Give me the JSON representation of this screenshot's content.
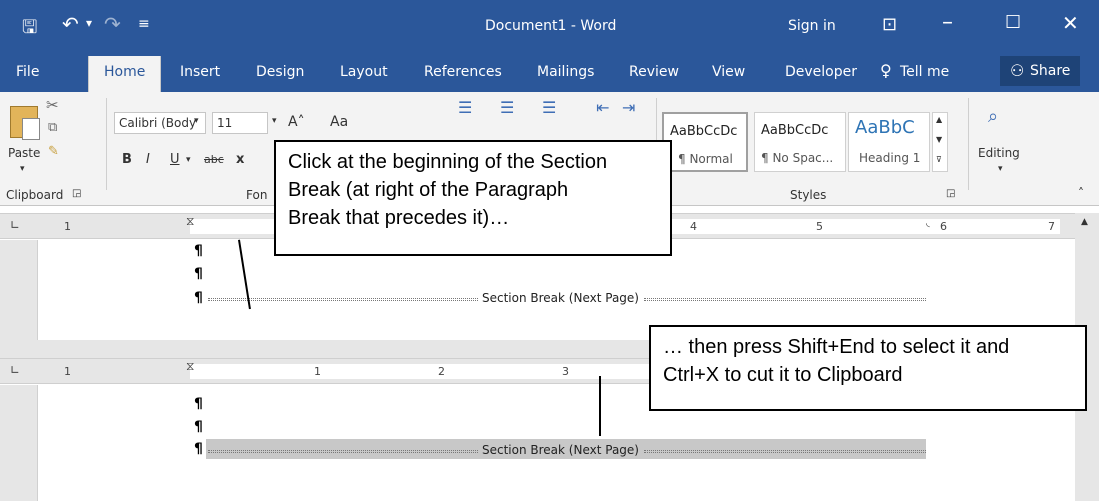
{
  "title_bar": {
    "title": "Document1 - Word",
    "sign_in": "Sign in",
    "undo_icon": "undo-icon",
    "redo_icon": "redo-icon",
    "save_icon": "save-icon"
  },
  "tabs": [
    "File",
    "Home",
    "Insert",
    "Design",
    "Layout",
    "References",
    "Mailings",
    "Review",
    "View",
    "Developer",
    "Tell me",
    "Share"
  ],
  "ribbon": {
    "paste_label": "Paste",
    "clipboard_label": "Clipboard",
    "font_name": "Calibri (Body",
    "font_size": "11",
    "font_label": "Fon",
    "bold": "B",
    "italic": "I",
    "underline": "U",
    "strike": "abc",
    "subscript": "x",
    "aa": "Aa",
    "styles": [
      {
        "sample": "AaBbCcDc",
        "name": "¶ Normal"
      },
      {
        "sample": "AaBbCcDc",
        "name": "¶ No Spac..."
      },
      {
        "sample": "AaBbC",
        "name": "Heading 1"
      }
    ],
    "styles_label": "Styles",
    "editing_label": "Editing"
  },
  "ruler_numbers": [
    "1",
    "1",
    "2",
    "3",
    "4",
    "5",
    "6",
    "7"
  ],
  "page1": {
    "pilcrow": "¶",
    "section_break": "Section Break (Next Page)"
  },
  "page2": {
    "pilcrow": "¶",
    "section_break": "Section Break (Next Page)"
  },
  "callouts": {
    "first": [
      "Click at the beginning of the Section",
      "Break (at right of the Paragraph",
      "Break that precedes it)…"
    ],
    "second": [
      "… then press Shift+End to select it and",
      "Ctrl+X to cut it to Clipboard"
    ]
  }
}
